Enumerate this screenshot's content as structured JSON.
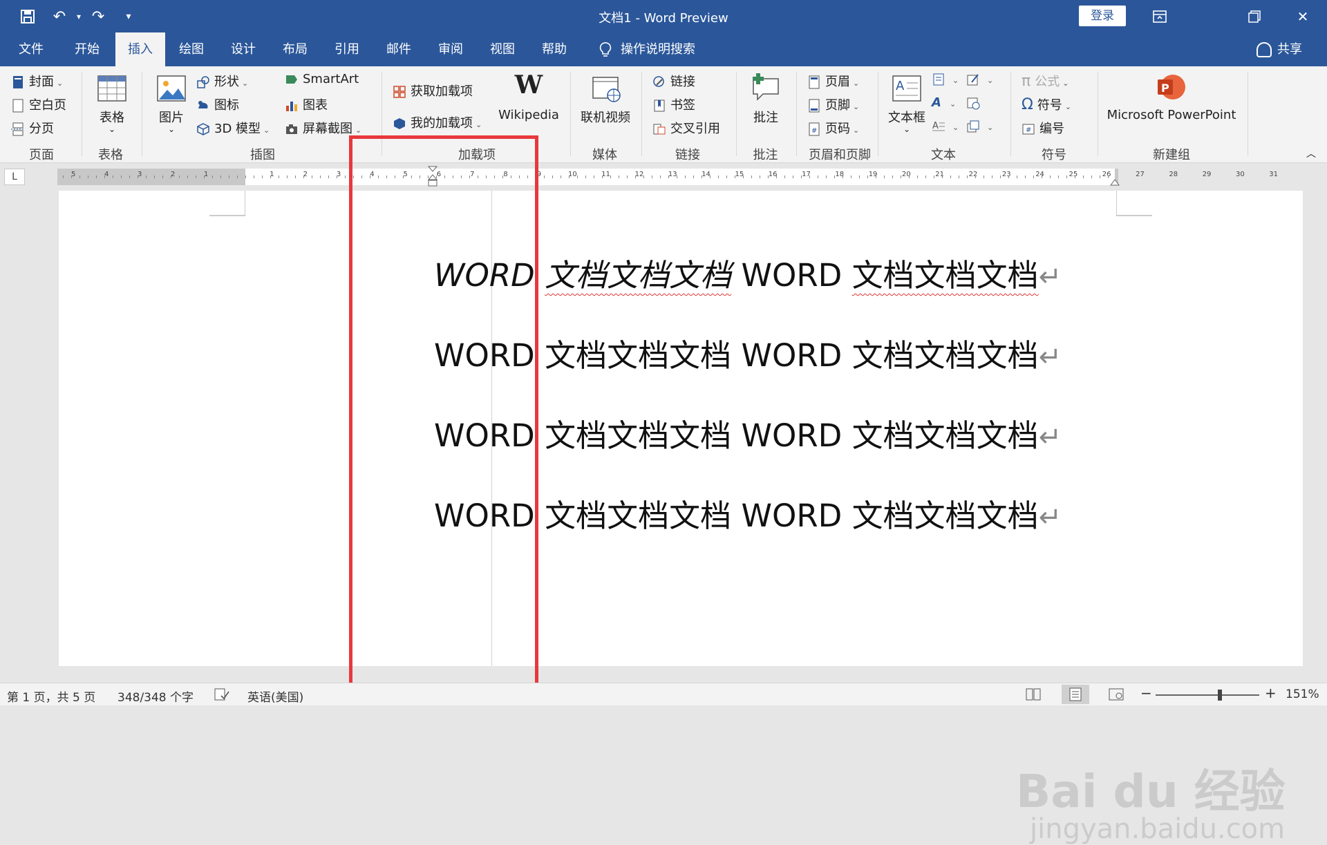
{
  "titlebar": {
    "title": "文档1  -  Word Preview",
    "login": "登录",
    "colors": {
      "brand": "#2b579a"
    }
  },
  "menu": {
    "tabs": [
      "文件",
      "开始",
      "插入",
      "绘图",
      "设计",
      "布局",
      "引用",
      "邮件",
      "审阅",
      "视图",
      "帮助"
    ],
    "active": "插入",
    "tell_me": "操作说明搜索",
    "share": "共享"
  },
  "ribbon": {
    "page_group": {
      "label": "页面",
      "cover": "封面",
      "blank": "空白页",
      "break": "分页"
    },
    "table_group": {
      "label": "表格",
      "table": "表格"
    },
    "illustrations_group": {
      "label": "插图",
      "picture": "图片",
      "shapes": "形状",
      "icons": "图标",
      "model3d": "3D 模型",
      "smartart": "SmartArt",
      "chart": "图表",
      "screenshot": "屏幕截图"
    },
    "addins_group": {
      "label": "加载项",
      "get": "获取加载项",
      "my": "我的加载项",
      "wikipedia": "Wikipedia"
    },
    "media_group": {
      "label": "媒体",
      "video": "联机视频"
    },
    "links_group": {
      "label": "链接",
      "link": "链接",
      "bookmark": "书签",
      "crossref": "交叉引用"
    },
    "comments_group": {
      "label": "批注",
      "comment": "批注"
    },
    "header_group": {
      "label": "页眉和页脚",
      "header": "页眉",
      "footer": "页脚",
      "pagenum": "页码"
    },
    "text_group": {
      "label": "文本",
      "textbox": "文本框"
    },
    "symbols_group": {
      "label": "符号",
      "equation": "公式",
      "symbol": "符号",
      "number": "编号"
    },
    "new_group": {
      "label": "新建组",
      "powerpoint": "Microsoft PowerPoint"
    }
  },
  "ruler": {
    "left_numbers": [
      "5",
      "4",
      "3",
      "2",
      "1"
    ],
    "right_numbers": [
      "1",
      "2",
      "3",
      "4",
      "5",
      "6",
      "7",
      "8",
      "9",
      "10",
      "11",
      "12",
      "13",
      "14",
      "15",
      "16",
      "17",
      "18",
      "19",
      "20",
      "21",
      "22",
      "23",
      "24",
      "25",
      "26",
      "27",
      "28",
      "29",
      "30",
      "31"
    ]
  },
  "document": {
    "lines": [
      {
        "a": "WORD ",
        "b": "文档文档文档",
        "c": " WORD ",
        "d": "文档文档文档",
        "pm": "↵",
        "italic": true
      },
      {
        "a": "WORD ",
        "b": "文档文档文档",
        "c": " WORD ",
        "d": "文档文档文档",
        "pm": "↵",
        "italic": false
      },
      {
        "a": "WORD ",
        "b": "文档文档文档",
        "c": " WORD ",
        "d": "文档文档文档",
        "pm": "↵",
        "italic": false
      },
      {
        "a": "WORD ",
        "b": "文档文档文档",
        "c": " WORD ",
        "d": "文档文档文档",
        "pm": "↵",
        "italic": false
      }
    ]
  },
  "watermark": {
    "text": "Bai du 经验",
    "sub": "jingyan.baidu.com"
  },
  "statusbar": {
    "page": "第 1 页，共 5 页",
    "words": "348/348 个字",
    "language": "英语(美国)",
    "zoom": "151%",
    "zoom_minus": "−",
    "zoom_plus": "+",
    "zoom_level_fraction": 0.62
  },
  "highlight_color": "#e8383d"
}
